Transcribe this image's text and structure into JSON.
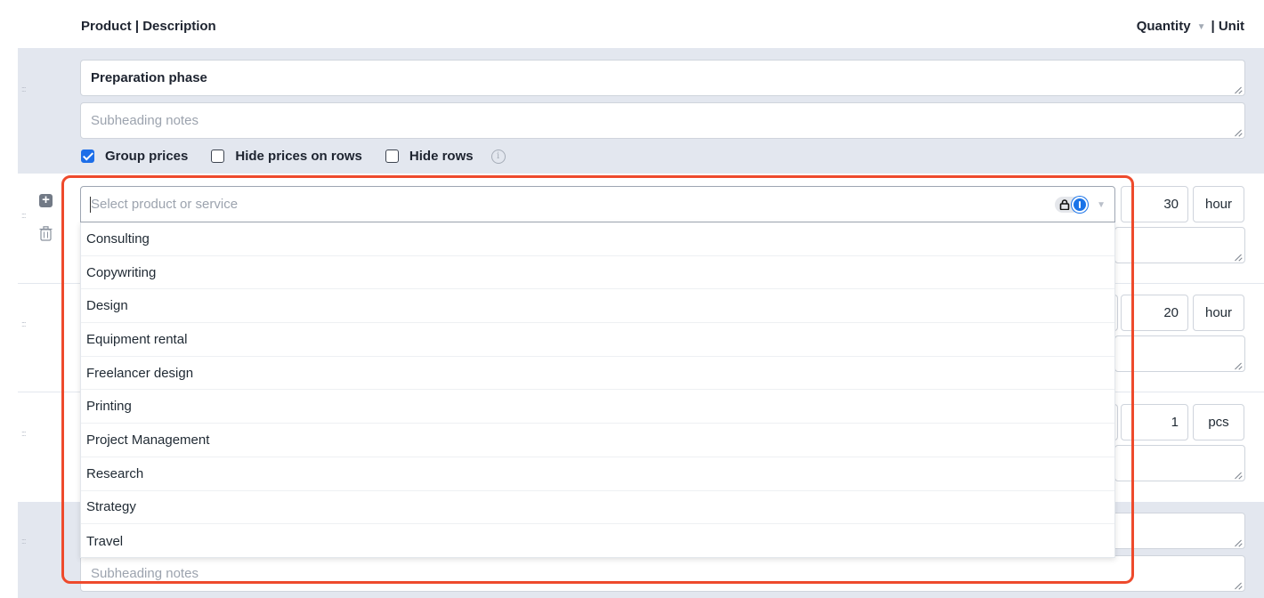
{
  "header": {
    "left_label": "Product | Description",
    "quantity_label": "Quantity",
    "unit_label": "| Unit"
  },
  "group": {
    "title": "Preparation phase",
    "subheading_placeholder": "Subheading notes",
    "options": [
      {
        "label": "Group prices",
        "checked": true
      },
      {
        "label": "Hide prices on rows",
        "checked": false
      },
      {
        "label": "Hide rows",
        "checked": false
      }
    ]
  },
  "product_select": {
    "placeholder": "Select product or service",
    "options": [
      "Consulting",
      "Copywriting",
      "Design",
      "Equipment rental",
      "Freelancer design",
      "Printing",
      "Project Management",
      "Research",
      "Strategy",
      "Travel"
    ]
  },
  "rows": [
    {
      "quantity": "30",
      "unit": "hour"
    },
    {
      "quantity": "20",
      "unit": "hour"
    },
    {
      "quantity": "1",
      "unit": "pcs"
    }
  ],
  "group2": {
    "subheading_placeholder": "Subheading notes"
  },
  "colors": {
    "highlight": "#ee4a2c",
    "group_band": "#e3e7ef",
    "checkbox_accent": "#1d6ee8",
    "password_manager": "#1a73e8"
  },
  "icons": [
    "drag-handle-icon",
    "plus-icon",
    "trash-icon",
    "info-icon",
    "lock-icon",
    "password-key-icon",
    "chevron-down-icon",
    "resize-handle-icon"
  ]
}
